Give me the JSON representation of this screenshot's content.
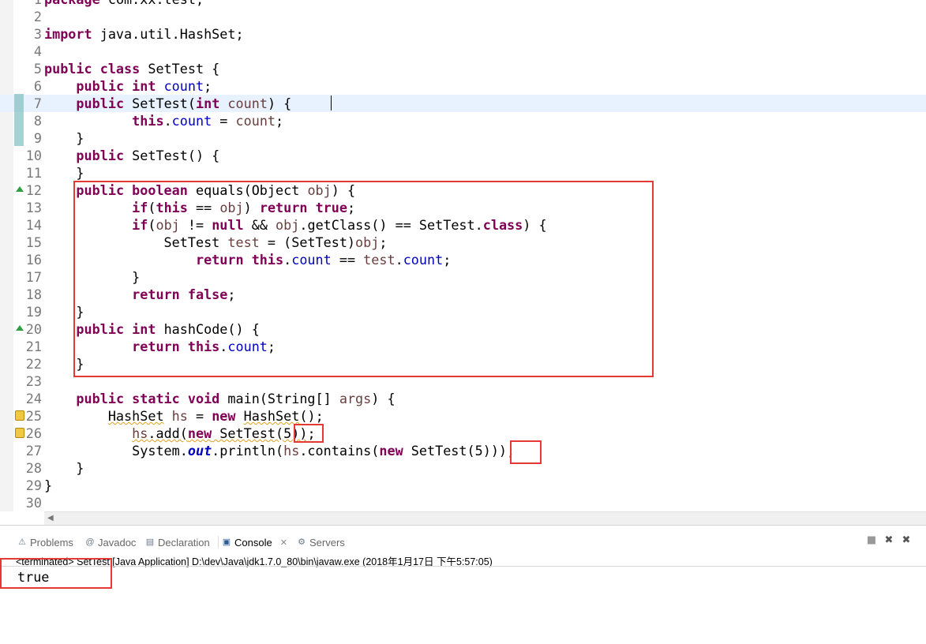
{
  "editor": {
    "lines": [
      {
        "n": "1",
        "html": "<span class=\"kw\">package</span> com.xx.test;"
      },
      {
        "n": "2",
        "html": ""
      },
      {
        "n": "3",
        "html": "<span class=\"kw\">import</span> java.util.HashSet;"
      },
      {
        "n": "4",
        "html": ""
      },
      {
        "n": "5",
        "html": "<span class=\"kw\">public class</span> SetTest {"
      },
      {
        "n": "6",
        "html": "    <span class=\"kw\">public int</span> <span class=\"fld\">count</span>;"
      },
      {
        "n": "7",
        "html": "    <span class=\"kw\">public</span> SetTest(<span class=\"kw\">int</span> <span class=\"prm\">count</span>) {"
      },
      {
        "n": "8",
        "html": "           <span class=\"kw\">this</span>.<span class=\"fld\">count</span> = <span class=\"prm\">count</span>;"
      },
      {
        "n": "9",
        "html": "    }"
      },
      {
        "n": "10",
        "html": "    <span class=\"kw\">public</span> SetTest() {"
      },
      {
        "n": "11",
        "html": "    }"
      },
      {
        "n": "12",
        "html": "    <span class=\"kw\">public boolean</span> equals(Object <span class=\"prm\">obj</span>) {"
      },
      {
        "n": "13",
        "html": "           <span class=\"kw\">if</span>(<span class=\"kw\">this</span> == <span class=\"prm\">obj</span>) <span class=\"kw\">return true</span>;"
      },
      {
        "n": "14",
        "html": "           <span class=\"kw\">if</span>(<span class=\"prm\">obj</span> != <span class=\"kw\">null</span> &amp;&amp; <span class=\"prm\">obj</span>.getClass() == SetTest.<span class=\"kw\">class</span>) {"
      },
      {
        "n": "15",
        "html": "               SetTest <span class=\"prm\">test</span> = (SetTest)<span class=\"prm\">obj</span>;"
      },
      {
        "n": "16",
        "html": "                   <span class=\"kw\">return this</span>.<span class=\"fld\">count</span> == <span class=\"prm\">test</span>.<span class=\"fld\">count</span>;"
      },
      {
        "n": "17",
        "html": "           }"
      },
      {
        "n": "18",
        "html": "           <span class=\"kw\">return false</span>;"
      },
      {
        "n": "19",
        "html": "    }"
      },
      {
        "n": "20",
        "html": "    <span class=\"kw\">public int</span> hashCode() {"
      },
      {
        "n": "21",
        "html": "           <span class=\"kw\">return this</span>.<span class=\"fld\">count</span>;"
      },
      {
        "n": "22",
        "html": "    }"
      },
      {
        "n": "23",
        "html": ""
      },
      {
        "n": "24",
        "html": "    <span class=\"kw\">public static void</span> main(String[] <span class=\"prm\">args</span>) {"
      },
      {
        "n": "25",
        "html": "        <span class=\"wavy\">HashSet</span> <span class=\"prm\">hs</span> = <span class=\"kw\">new</span> <span class=\"wavy\">HashSet</span>();"
      },
      {
        "n": "26",
        "html": "           <span class=\"wavy\"><span class=\"prm\">hs</span>.add(<span class=\"kw\">new</span> SetTest(5))</span>;"
      },
      {
        "n": "27",
        "html": "           System.<span class=\"sfld\">out</span>.println(<span class=\"prm\">hs</span>.contains(<span class=\"kw\">new</span> SetTest(5)));"
      },
      {
        "n": "28",
        "html": "    }"
      },
      {
        "n": "29",
        "html": "}"
      },
      {
        "n": "30",
        "html": ""
      }
    ]
  },
  "panel": {
    "tabs": [
      {
        "label": "Problems",
        "icon": "problems-icon"
      },
      {
        "label": "Javadoc",
        "icon": "javadoc-icon"
      },
      {
        "label": "Declaration",
        "icon": "declaration-icon"
      },
      {
        "label": "Console",
        "icon": "console-icon",
        "active": true
      },
      {
        "label": "Servers",
        "icon": "servers-icon"
      }
    ],
    "close_glyph": "✕",
    "terminated": "<terminated> SetTest [Java Application] D:\\dev\\Java\\jdk1.7.0_80\\bin\\javaw.exe (2018年1月17日 下午5:57:05)",
    "output": "true"
  },
  "colors": {
    "keyword": "#7f0055",
    "field": "#0000c0",
    "parameter": "#6a3e3e",
    "annotation_box": "#e53935",
    "current_line": "#e8f2fe"
  }
}
